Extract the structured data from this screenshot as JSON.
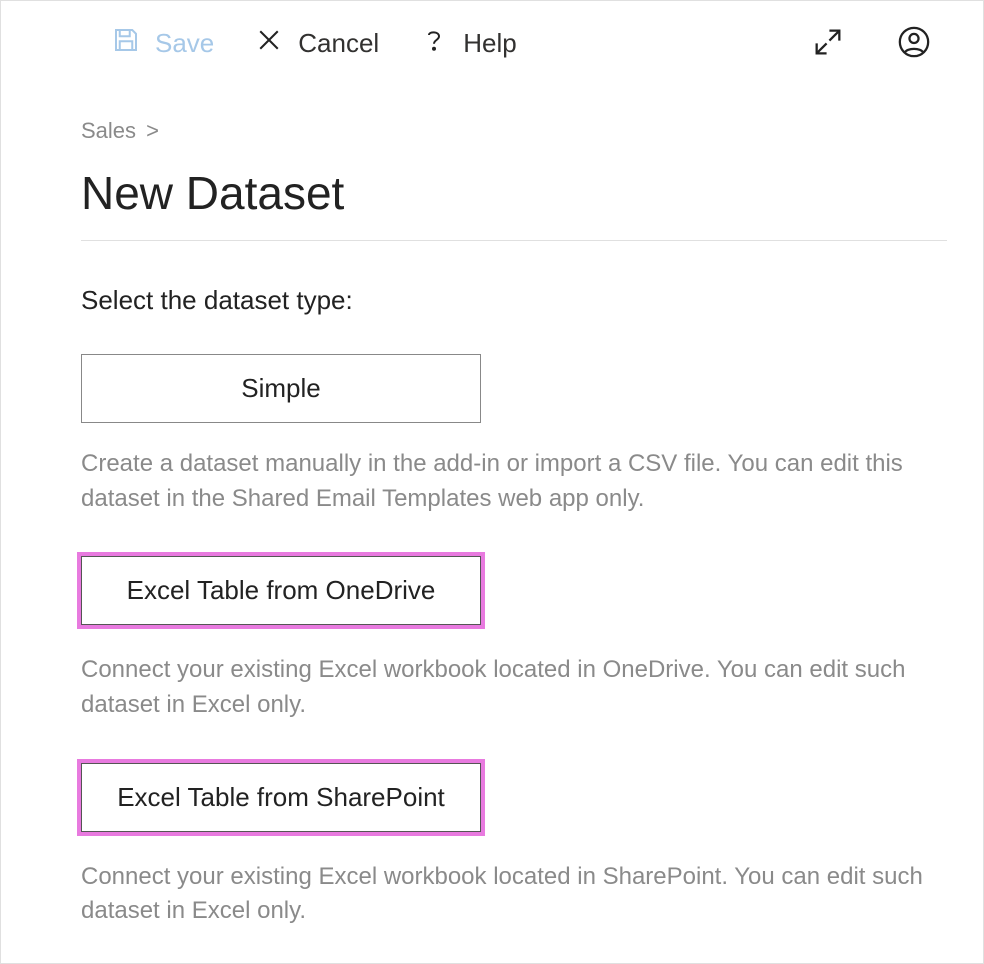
{
  "toolbar": {
    "save_label": "Save",
    "cancel_label": "Cancel",
    "help_label": "Help"
  },
  "breadcrumb": {
    "item": "Sales",
    "separator": ">"
  },
  "page": {
    "title": "New Dataset",
    "prompt": "Select the dataset type:"
  },
  "options": [
    {
      "label": "Simple",
      "highlight": false,
      "description": "Create a dataset manually in the add-in or import a CSV file. You can edit this dataset in the Shared Email Templates web app only."
    },
    {
      "label": "Excel Table from OneDrive",
      "highlight": true,
      "description": "Connect your existing Excel workbook located in OneDrive. You can edit such dataset in Excel only."
    },
    {
      "label": "Excel Table from SharePoint",
      "highlight": true,
      "description": "Connect your existing Excel workbook located in SharePoint. You can edit such dataset in Excel only."
    }
  ],
  "colors": {
    "highlight": "#e87adf",
    "save_disabled": "#a6c8e8",
    "muted": "#8a8a8a"
  }
}
